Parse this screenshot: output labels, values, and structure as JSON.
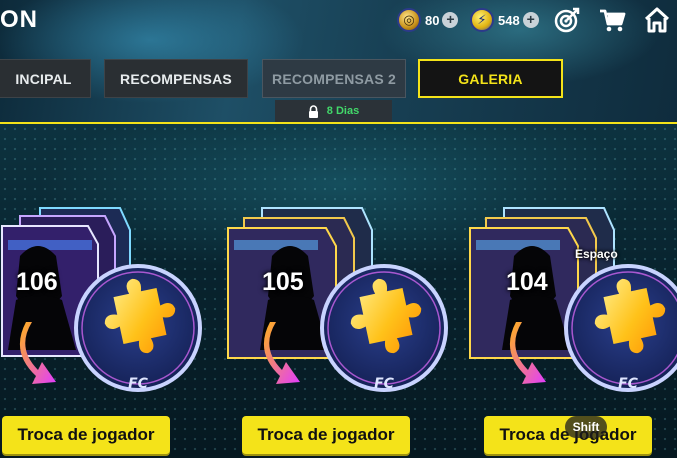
{
  "header": {
    "title": "ON",
    "coins": {
      "value": "80",
      "icon": "coin-icon"
    },
    "points": {
      "value": "548",
      "icon": "fc-points-icon"
    },
    "icons": [
      "objectives-target-icon",
      "store-cart-icon",
      "home-icon"
    ]
  },
  "tabs": [
    {
      "label": "INCIPAL",
      "state": "normal"
    },
    {
      "label": "RECOMPENSAS",
      "state": "normal"
    },
    {
      "label": "RECOMPENSAS 2",
      "state": "disabled"
    },
    {
      "label": "GALERIA",
      "state": "active"
    }
  ],
  "lock": {
    "text": "8 Dias"
  },
  "cards": [
    {
      "rating": "106",
      "button": "Troca de jogador"
    },
    {
      "rating": "105",
      "button": "Troca de jogador"
    },
    {
      "rating": "104",
      "button": "Troca de jogador"
    }
  ],
  "hints": {
    "space": "Espaço",
    "shift": "Shift"
  },
  "colors": {
    "accent": "#f4e319",
    "lock_text": "#42d86a",
    "tab_bg": "#2a2f33"
  }
}
